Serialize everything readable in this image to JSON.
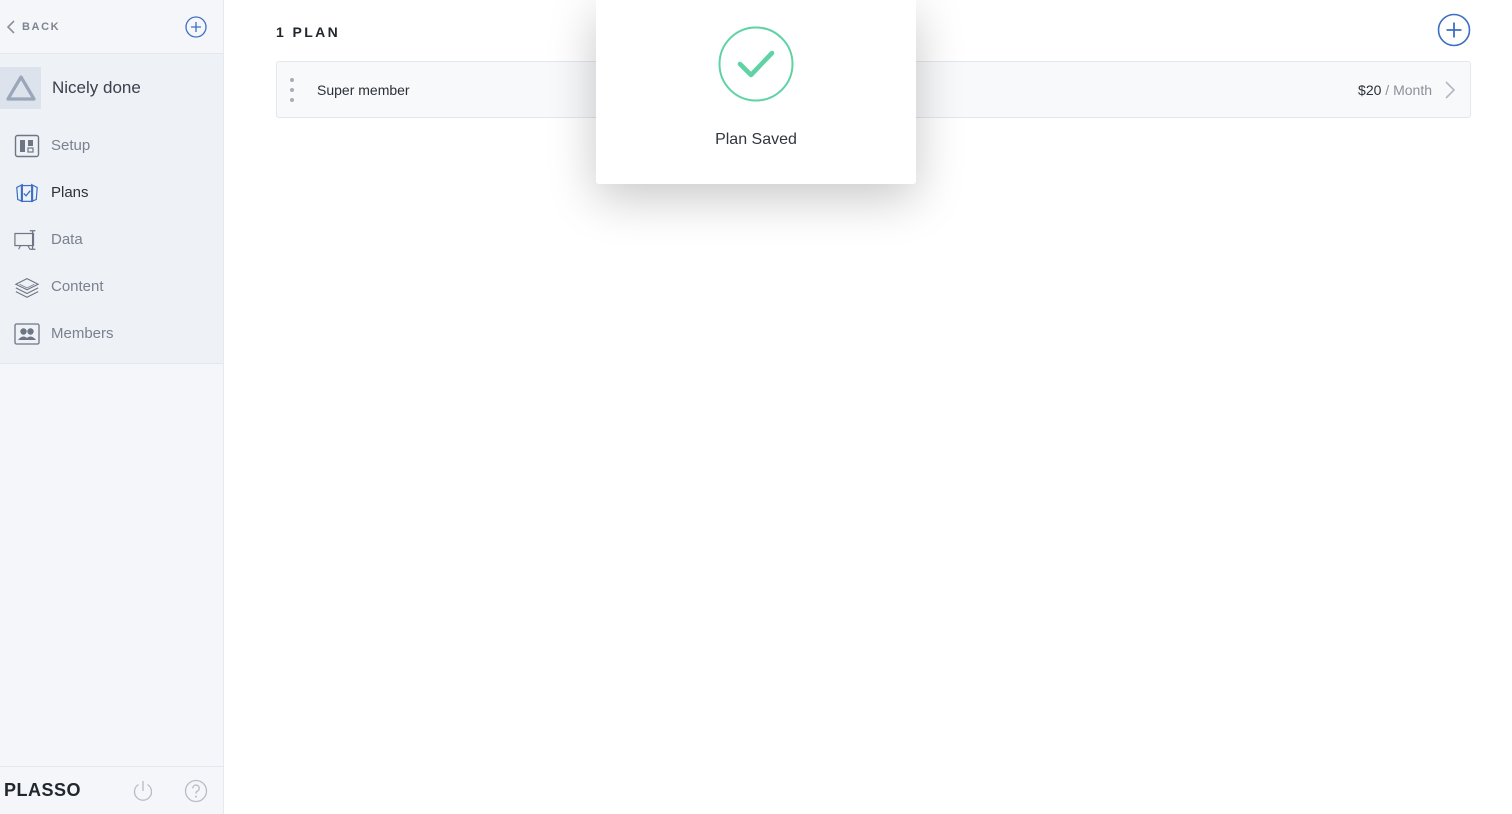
{
  "sidebar": {
    "back_label": "BACK",
    "site_name": "Nicely done",
    "items": [
      {
        "label": "Setup",
        "icon": "setup-icon"
      },
      {
        "label": "Plans",
        "icon": "plans-icon",
        "active": true
      },
      {
        "label": "Data",
        "icon": "data-icon"
      },
      {
        "label": "Content",
        "icon": "content-icon"
      },
      {
        "label": "Members",
        "icon": "members-icon"
      }
    ],
    "brand": "PLASSO"
  },
  "main": {
    "heading": "1 PLAN",
    "plans": [
      {
        "name": "Super member",
        "price": "$20",
        "separator": "/",
        "period": "Month"
      }
    ]
  },
  "toast": {
    "message": "Plan Saved"
  },
  "colors": {
    "accent_blue": "#3c6fc4",
    "success_green": "#5fd3a5",
    "sidebar_bg": "#f4f6fa"
  }
}
